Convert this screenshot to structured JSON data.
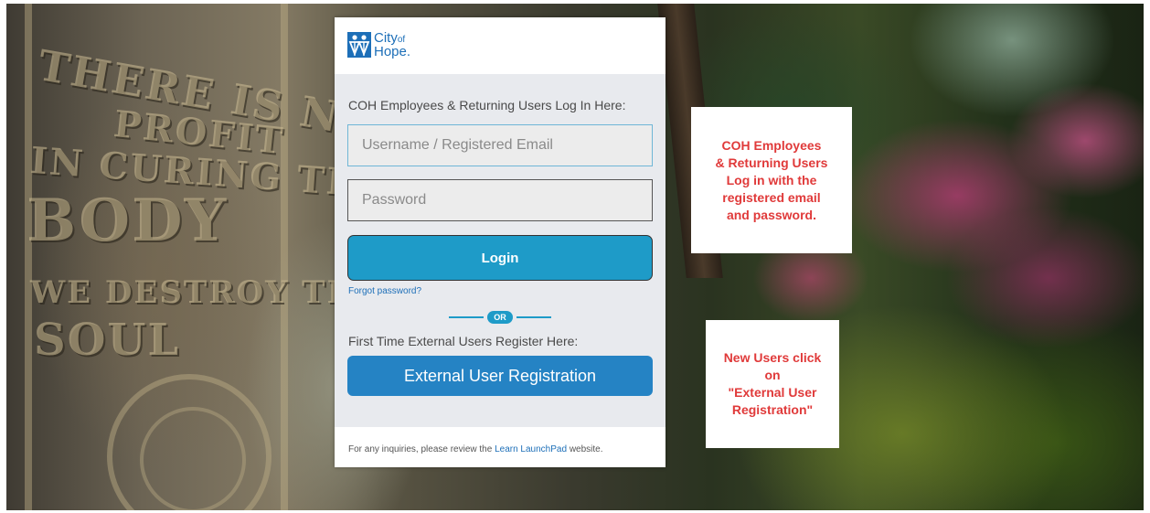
{
  "logo": {
    "line1": "City",
    "line1_small": "of",
    "line2": "Hope."
  },
  "login": {
    "heading": "COH Employees & Returning Users Log In Here:",
    "username_placeholder": "Username / Registered Email",
    "password_placeholder": "Password",
    "login_label": "Login",
    "forgot_label": "Forgot password?"
  },
  "divider": {
    "label": "OR"
  },
  "register": {
    "heading": "First Time External Users Register Here:",
    "button_label": "External User Registration"
  },
  "footer": {
    "prefix": "For any inquiries, please review the ",
    "link": "Learn LaunchPad",
    "suffix": " website."
  },
  "callouts": {
    "returning_lines": [
      "COH Employees",
      "& Returning Users",
      "Log in with the",
      "registered email",
      "and password."
    ],
    "new_lines": [
      "New Users click",
      "on",
      "\"External User",
      "Registration\""
    ]
  },
  "background": {
    "gate_words": [
      "THERE IS NO",
      "PROFIT",
      "IN CURING THE",
      "BODY",
      "WE DESTROY THE",
      "SOUL"
    ]
  },
  "colors": {
    "brand_blue": "#1d6fb8",
    "login_button": "#1e9bc8",
    "register_button": "#2583c4",
    "callout_text": "#e03a3a"
  }
}
